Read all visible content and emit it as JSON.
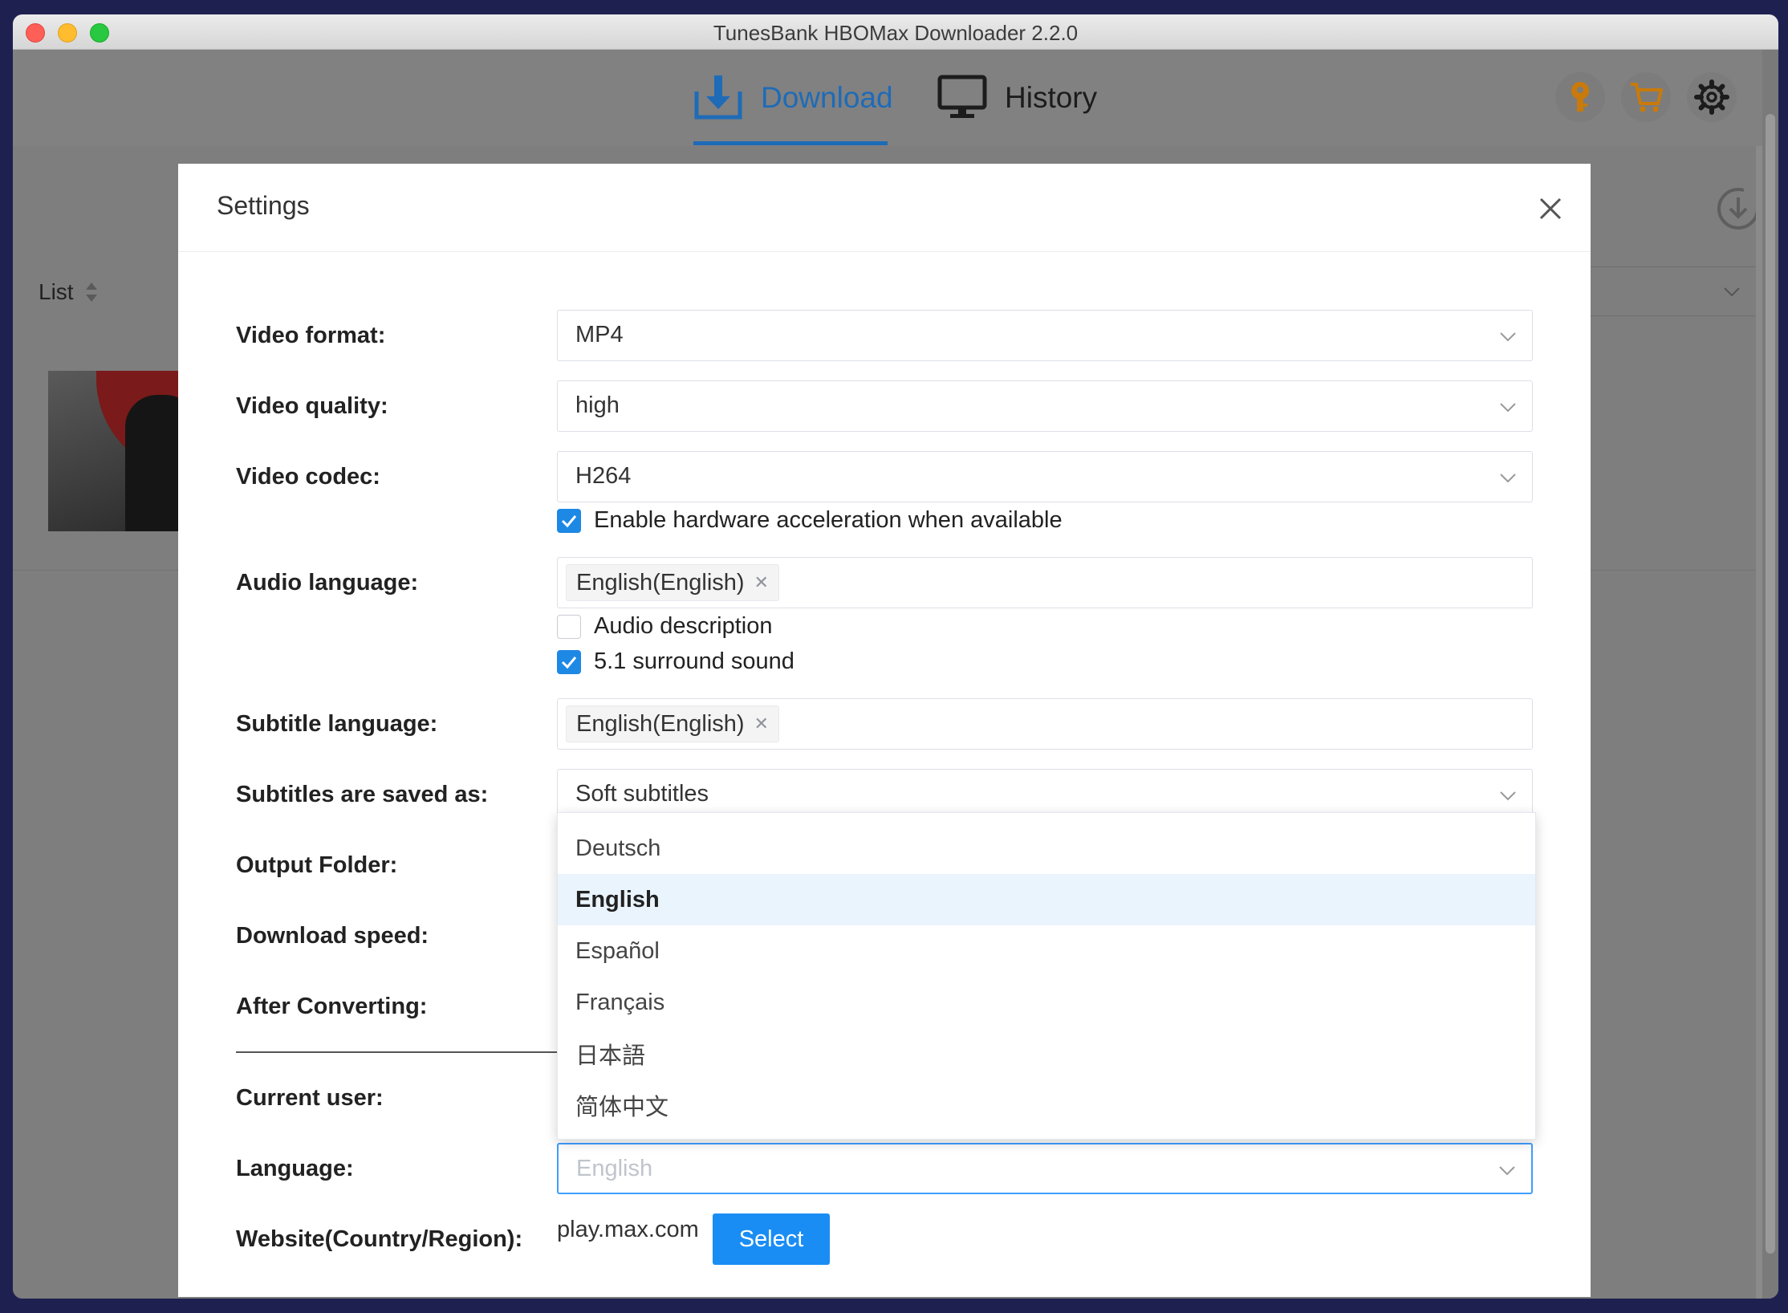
{
  "window": {
    "title": "TunesBank HBOMax Downloader 2.2.0"
  },
  "nav": {
    "tabs": [
      {
        "label": "Download",
        "icon": "download-tray-icon",
        "active": true
      },
      {
        "label": "History",
        "icon": "monitor-icon",
        "active": false
      }
    ],
    "actions": [
      "key-icon",
      "cart-icon",
      "gear-icon"
    ],
    "accent_color": "#1e6bb8"
  },
  "main": {
    "list_label": "List"
  },
  "settings": {
    "title": "Settings",
    "video_format": {
      "label": "Video format:",
      "value": "MP4"
    },
    "video_quality": {
      "label": "Video quality:",
      "value": "high"
    },
    "video_codec": {
      "label": "Video codec:",
      "value": "H264"
    },
    "hw_accel": {
      "label": "Enable hardware acceleration when available",
      "checked": true
    },
    "audio_language": {
      "label": "Audio language:",
      "tag": "English(English)"
    },
    "audio_description": {
      "label": "Audio description",
      "checked": false
    },
    "surround": {
      "label": "5.1 surround sound",
      "checked": true
    },
    "subtitle_language": {
      "label": "Subtitle language:",
      "tag": "English(English)"
    },
    "subtitles_saved_as": {
      "label": "Subtitles are saved as:",
      "value": "Soft subtitles"
    },
    "output_folder": {
      "label": "Output Folder:"
    },
    "download_speed": {
      "label": "Download speed:"
    },
    "after_converting": {
      "label": "After Converting:"
    },
    "current_user": {
      "label": "Current user:"
    },
    "language": {
      "label": "Language:",
      "value": "English",
      "options": [
        "Deutsch",
        "English",
        "Español",
        "Français",
        "日本語",
        "简体中文"
      ],
      "selected": "English"
    },
    "website": {
      "label": "Website(Country/Region):",
      "value": "play.max.com",
      "button": "Select"
    }
  }
}
